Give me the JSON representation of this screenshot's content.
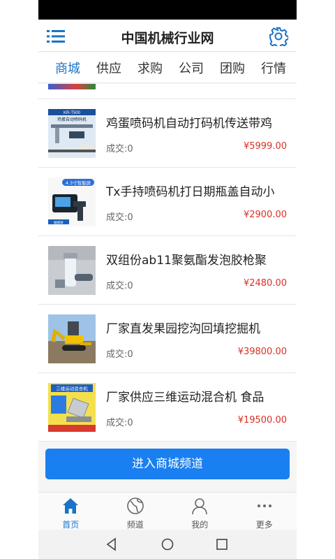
{
  "app": {
    "title": "中国机械行业网"
  },
  "tabs": [
    {
      "label": "商城",
      "active": true
    },
    {
      "label": "供应"
    },
    {
      "label": "求购"
    },
    {
      "label": "公司"
    },
    {
      "label": "团购"
    },
    {
      "label": "行情"
    }
  ],
  "products": [
    {
      "title": "鸡蛋喷码机自动打码机传送带鸡",
      "sold": "成交:0",
      "price": "¥5999.00",
      "thumb_text": "KR-T500",
      "thumb_sub": "鸡蛋自动喷码机"
    },
    {
      "title": "Tx手持喷码机打日期瓶盖自动小",
      "sold": "成交:0",
      "price": "¥2900.00",
      "thumb_text": "4.3寸智能屏",
      "thumb_sub": "触摸屏"
    },
    {
      "title": "双组份ab11聚氨酯发泡胶枪聚",
      "sold": "成交:0",
      "price": "¥2480.00"
    },
    {
      "title": "厂家直发果园挖沟回填挖掘机",
      "sold": "成交:0",
      "price": "¥39800.00"
    },
    {
      "title": "厂家供应三维运动混合机 食品",
      "sold": "成交:0",
      "price": "¥19500.00",
      "thumb_text": "三维运动混合机"
    }
  ],
  "enter_button": "进入商城频道",
  "bottom_tabs": [
    {
      "label": "首页",
      "icon": "home-icon",
      "active": true
    },
    {
      "label": "频道",
      "icon": "globe-icon"
    },
    {
      "label": "我的",
      "icon": "user-icon"
    },
    {
      "label": "更多",
      "icon": "more-icon"
    }
  ],
  "colors": {
    "accent": "#1a73c6",
    "button": "#1a7ff0",
    "price": "#d93025"
  }
}
